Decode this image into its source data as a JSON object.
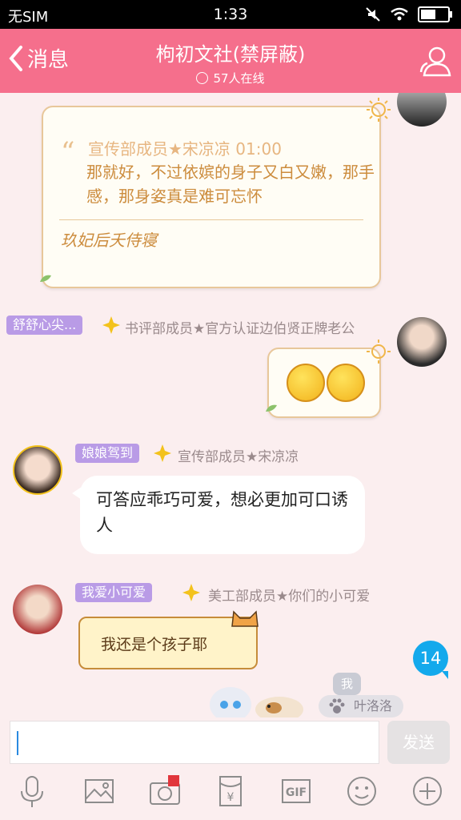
{
  "status_bar": {
    "carrier": "无SIM",
    "time": "1:33"
  },
  "header": {
    "back_label": "消息",
    "title": "枸初文社(禁屏蔽)",
    "online": "57人在线"
  },
  "messages": {
    "quote": {
      "author_time": "宣传部成员★宋凉凉 01:00",
      "text": "那就好，不过依嫔的身子又白又嫩，那手感，那身姿真是难可忘怀",
      "signature": "玖妃后夭侍寝"
    },
    "msg2": {
      "tag": "舒舒心尖...",
      "rank": "书评部成员★官方认证边伯贤正牌老公"
    },
    "msg3": {
      "tag": "娘娘驾到",
      "rank": "宣传部成员★宋凉凉",
      "text": "可答应乖巧可爱，想必更加可口诱人"
    },
    "msg4": {
      "tag": "我爱小可爱",
      "rank": "美工部成员★你们的小可爱",
      "sticker_text": "我还是个孩子耶"
    }
  },
  "unread_badge": "14",
  "bottom_overlay": {
    "me_label": "我",
    "name": "叶洛洛"
  },
  "input": {
    "placeholder": "",
    "send_label": "发送"
  },
  "toolbar": {
    "gif_label": "GIF",
    "yen_label": "¥"
  },
  "colors": {
    "header": "#f56f8c",
    "tag": "#b99be6",
    "badge": "#13a9ec"
  }
}
